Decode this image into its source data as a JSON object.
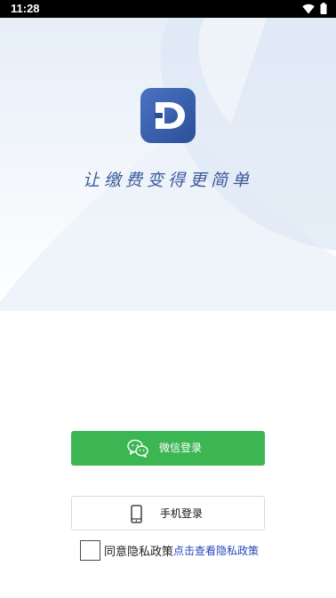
{
  "status_bar": {
    "time": "11:28",
    "icons": [
      "wifi-icon",
      "battery-icon"
    ]
  },
  "branding": {
    "logo_icon": "d-logo-icon",
    "slogan": "让缴费变得更简单",
    "slogan_color": "#3a5a9a"
  },
  "login": {
    "wechat_button": {
      "label": "微信登录",
      "icon": "wechat-icon",
      "color": "#3cb553"
    },
    "phone_button": {
      "label": "手机登录",
      "icon": "phone-icon"
    }
  },
  "privacy": {
    "agree_text": "同意隐私政策",
    "link_text": "点击查看隐私政策",
    "checked": false,
    "link_color": "#2346b8"
  }
}
